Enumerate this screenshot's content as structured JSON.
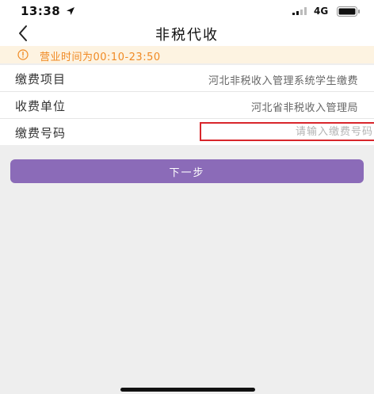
{
  "status_bar": {
    "time": "13:38",
    "network": "4G"
  },
  "nav": {
    "title": "非税代收"
  },
  "notice": {
    "text": "营业时间为00:10-23:50",
    "icon": "info-circle-icon",
    "color": "#f08a24"
  },
  "form": {
    "rows": [
      {
        "label": "缴费项目",
        "value": "河北非税收入管理系统学生缴费"
      },
      {
        "label": "收费单位",
        "value": "河北省非税收入管理局"
      },
      {
        "label": "缴费号码",
        "placeholder": "请输入缴费号码"
      }
    ]
  },
  "next_button": {
    "label": "下一步",
    "color": "#8b6bb8"
  },
  "colors": {
    "input_border": "#d8262c",
    "background": "#eeeeee"
  }
}
